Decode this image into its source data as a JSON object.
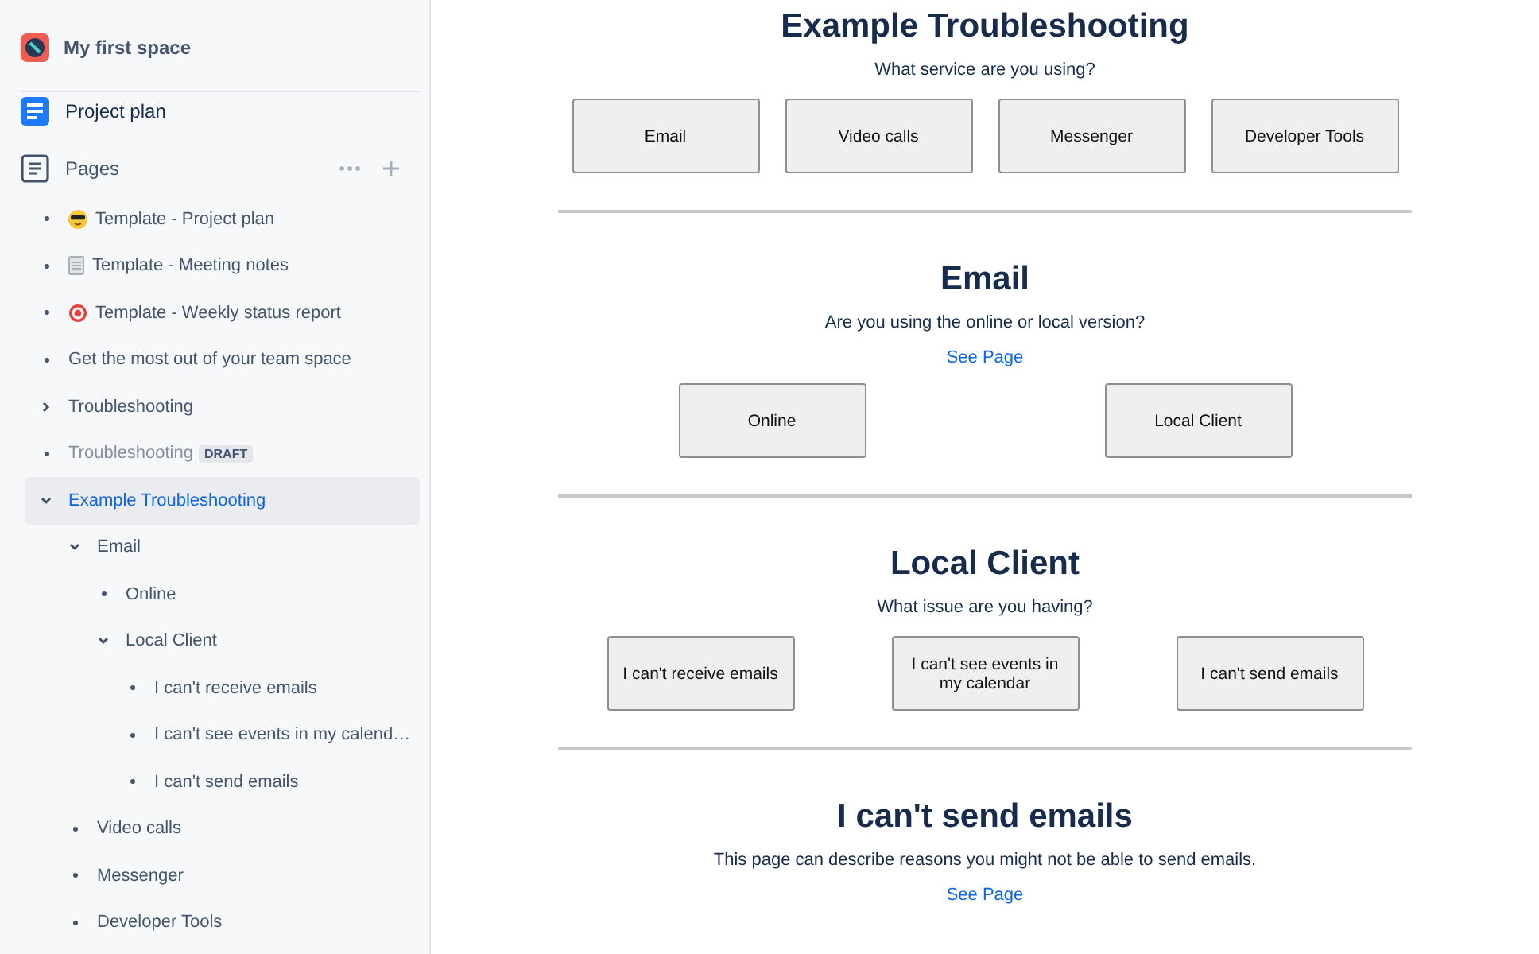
{
  "sidebar": {
    "space_name": "My first space",
    "shortcut": "Project plan",
    "section_label": "Pages",
    "pages": [
      {
        "kind": "emoji",
        "label": "Template - Project plan",
        "selected": false,
        "draft": false
      },
      {
        "kind": "emoji",
        "label": "Template - Meeting notes",
        "selected": false,
        "draft": false
      },
      {
        "kind": "emoji",
        "label": "Template - Weekly status report",
        "selected": false,
        "draft": false
      },
      {
        "kind": "leaf",
        "label": "Get the most out of your team space",
        "selected": false,
        "draft": false
      },
      {
        "kind": "folder",
        "expanded": false,
        "label": "Troubleshooting",
        "selected": false,
        "draft": false
      },
      {
        "kind": "leaf",
        "label": "Troubleshooting",
        "selected": false,
        "draft": true,
        "badge": "DRAFT"
      },
      {
        "kind": "folder",
        "expanded": true,
        "label": "Example Troubleshooting",
        "selected": true,
        "draft": false,
        "children": [
          {
            "kind": "folder",
            "expanded": true,
            "label": "Email",
            "selected": false,
            "draft": false,
            "children": [
              {
                "kind": "leaf",
                "label": "Online",
                "selected": false,
                "draft": false
              },
              {
                "kind": "folder",
                "expanded": true,
                "label": "Local Client",
                "selected": false,
                "draft": false,
                "children": [
                  {
                    "kind": "leaf",
                    "label": "I can't receive emails",
                    "selected": false,
                    "draft": false
                  },
                  {
                    "kind": "leaf",
                    "label": "I can't see events in my calend…",
                    "selected": false,
                    "draft": false
                  },
                  {
                    "kind": "leaf",
                    "label": "I can't send emails",
                    "selected": false,
                    "draft": false
                  }
                ]
              }
            ]
          },
          {
            "kind": "leaf",
            "label": "Video calls",
            "selected": false,
            "draft": false
          },
          {
            "kind": "leaf",
            "label": "Messenger",
            "selected": false,
            "draft": false
          },
          {
            "kind": "leaf",
            "label": "Developer Tools",
            "selected": false,
            "draft": false
          }
        ]
      }
    ]
  },
  "sections": [
    {
      "title": "Example Troubleshooting",
      "question": "What service are you using?",
      "options": [
        "Email",
        "Video calls",
        "Messenger",
        "Developer Tools"
      ]
    },
    {
      "title": "Email",
      "question": "Are you using the online or local version?",
      "link": "See Page",
      "options": [
        "Online",
        "Local Client"
      ]
    },
    {
      "title": "Local Client",
      "question": "What issue are you having?",
      "options": [
        "I can't receive emails",
        "I can't see events in my calendar",
        "I can't send emails"
      ]
    },
    {
      "title": "I can't send emails",
      "question": "This page can describe reasons you might not be able to send emails.",
      "link": "See Page"
    }
  ]
}
